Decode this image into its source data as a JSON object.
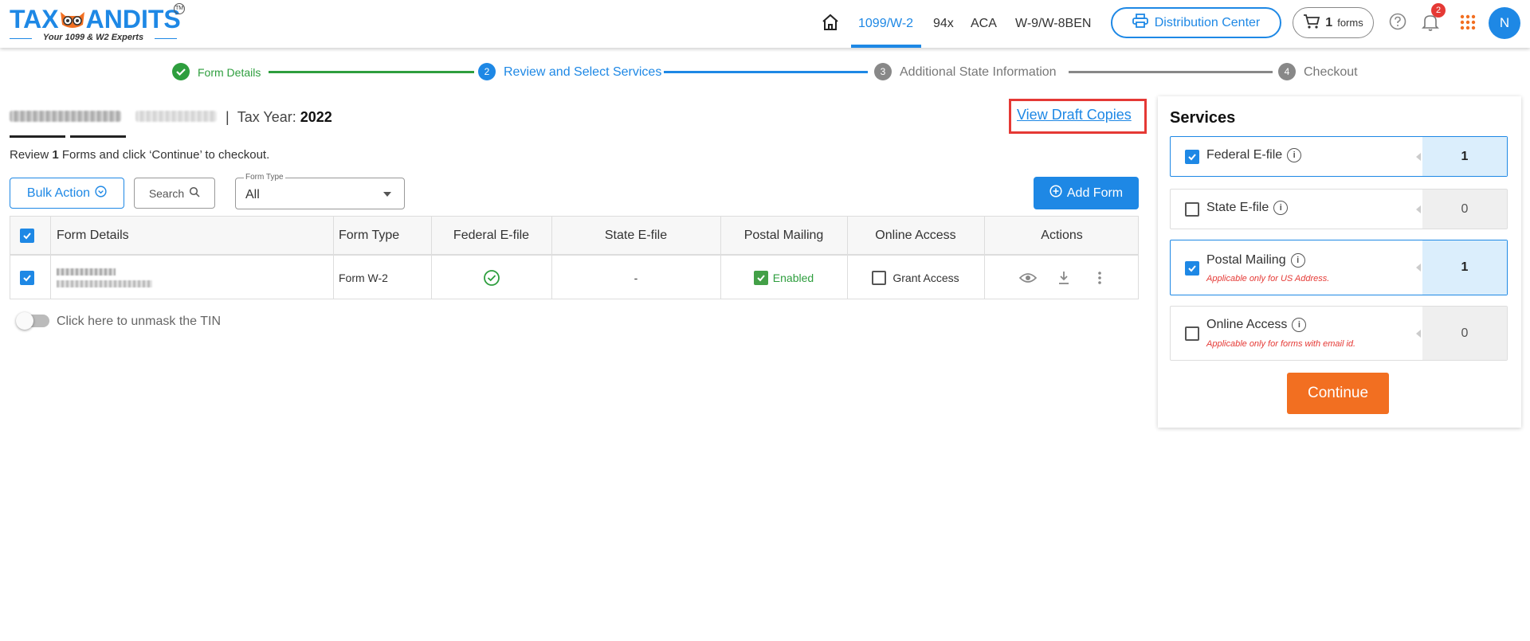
{
  "header": {
    "logo_text_left": "TAX",
    "logo_text_right": "ANDITS",
    "logo_tm": "TM",
    "logo_tagline": "Your 1099 & W2 Experts",
    "nav": [
      {
        "label": "1099/W-2",
        "active": true
      },
      {
        "label": "94x"
      },
      {
        "label": "ACA"
      },
      {
        "label": "W-9/W-8BEN"
      }
    ],
    "distribution_center_label": "Distribution Center",
    "cart_count": "1",
    "cart_label": "forms",
    "notifications_count": "2",
    "avatar_initial": "N",
    "accent_color": "#1e88e5"
  },
  "stepper": [
    {
      "num": "",
      "label": "Form Details",
      "status": "done"
    },
    {
      "num": "2",
      "label": "Review and Select Services",
      "status": "active"
    },
    {
      "num": "3",
      "label": "Additional State Information",
      "status": "pending"
    },
    {
      "num": "4",
      "label": "Checkout",
      "status": "pending"
    }
  ],
  "main": {
    "tax_year_label": "Tax Year:",
    "tax_year": "2022",
    "view_draft_copies": "View Draft Copies",
    "review_prefix": "Review",
    "review_count": "1",
    "review_suffix": "Forms and click ‘Continue’ to checkout.",
    "bulk_action_label": "Bulk Action",
    "search_label": "Search",
    "form_type_legend": "Form Type",
    "form_type_value": "All",
    "add_form_label": "Add Form",
    "unmask_label": "Click here to unmask the TIN"
  },
  "table": {
    "columns": [
      "Form Details",
      "Form Type",
      "Federal E-file",
      "State E-file",
      "Postal Mailing",
      "Online Access",
      "Actions"
    ],
    "rows": [
      {
        "form_type": "Form W-2",
        "state_efile": "-",
        "postal_mailing": "Enabled",
        "online_access": "Grant Access"
      }
    ]
  },
  "services": {
    "title": "Services",
    "items": [
      {
        "label": "Federal E-file",
        "count": "1",
        "checked": true,
        "note": ""
      },
      {
        "label": "State E-file",
        "count": "0",
        "checked": false,
        "note": ""
      },
      {
        "label": "Postal Mailing",
        "count": "1",
        "checked": true,
        "note": "Applicable only for US Address."
      },
      {
        "label": "Online Access",
        "count": "0",
        "checked": false,
        "note": "Applicable only for forms with email id."
      }
    ],
    "continue_label": "Continue",
    "continue_color": "#f26f21"
  }
}
